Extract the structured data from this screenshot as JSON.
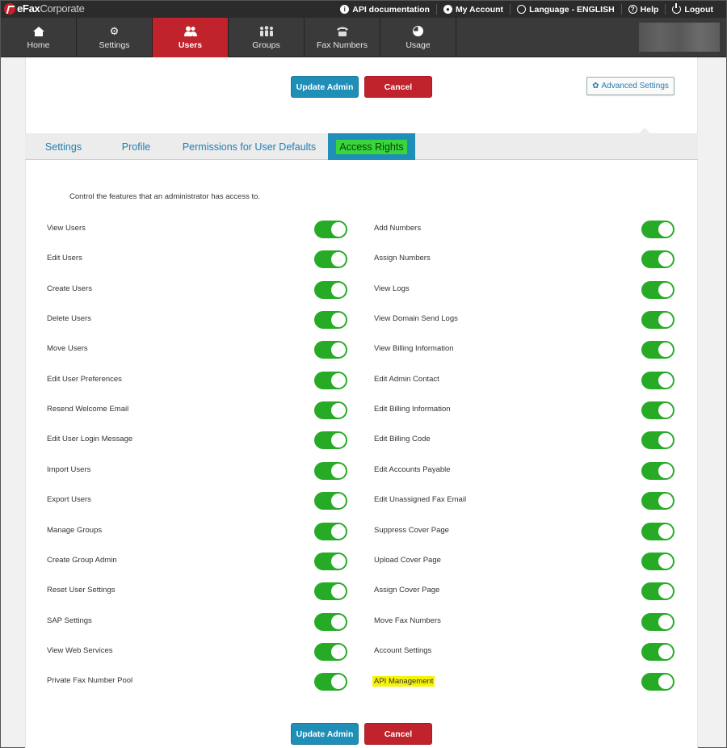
{
  "logo": {
    "bold": "eFax",
    "light": "Corporate"
  },
  "utility_links": [
    {
      "icon": "info-icon",
      "label": "API documentation"
    },
    {
      "icon": "account-icon",
      "label": "My Account"
    },
    {
      "icon": "globe-icon",
      "label": "Language - ENGLISH"
    },
    {
      "icon": "help-icon",
      "label": "Help"
    },
    {
      "icon": "power-icon",
      "label": "Logout"
    }
  ],
  "nav": [
    {
      "label": "Home",
      "icon": "home-icon"
    },
    {
      "label": "Settings",
      "icon": "gear-icon"
    },
    {
      "label": "Users",
      "icon": "users-icon",
      "active": true
    },
    {
      "label": "Groups",
      "icon": "groups-icon"
    },
    {
      "label": "Fax Numbers",
      "icon": "fax-icon"
    },
    {
      "label": "Usage",
      "icon": "pie-chart-icon"
    }
  ],
  "actions": {
    "update": "Update Admin",
    "cancel": "Cancel",
    "advanced": "Advanced Settings"
  },
  "tabs": [
    "Settings",
    "Profile",
    "Permissions for User Defaults",
    "Access Rights"
  ],
  "active_tab": "Access Rights",
  "intro": "Control the features that an administrator has access to.",
  "colors": {
    "accent_blue": "#1f8fb8",
    "danger_red": "#c0232b",
    "toggle_on": "#27ab27",
    "highlight_green": "#39d53b",
    "highlight_yellow": "#f6f30b"
  },
  "left_permissions": [
    {
      "label": "View Users",
      "on": true
    },
    {
      "label": "Edit Users",
      "on": true
    },
    {
      "label": "Create Users",
      "on": true
    },
    {
      "label": "Delete Users",
      "on": true
    },
    {
      "label": "Move Users",
      "on": true
    },
    {
      "label": "Edit User Preferences",
      "on": true
    },
    {
      "label": "Resend Welcome Email",
      "on": true
    },
    {
      "label": "Edit User Login Message",
      "on": true
    },
    {
      "label": "Import Users",
      "on": true
    },
    {
      "label": "Export Users",
      "on": true
    },
    {
      "label": "Manage Groups",
      "on": true
    },
    {
      "label": "Create Group Admin",
      "on": true
    },
    {
      "label": "Reset User Settings",
      "on": true
    },
    {
      "label": "SAP Settings",
      "on": true
    },
    {
      "label": "View Web Services",
      "on": true
    },
    {
      "label": "Private Fax Number Pool",
      "on": true
    }
  ],
  "right_permissions": [
    {
      "label": "Add Numbers",
      "on": true
    },
    {
      "label": "Assign Numbers",
      "on": true
    },
    {
      "label": "View Logs",
      "on": true
    },
    {
      "label": "View Domain Send Logs",
      "on": true
    },
    {
      "label": "View Billing Information",
      "on": true
    },
    {
      "label": "Edit Admin Contact",
      "on": true
    },
    {
      "label": "Edit Billing Information",
      "on": true
    },
    {
      "label": "Edit Billing Code",
      "on": true
    },
    {
      "label": "Edit Accounts Payable",
      "on": true
    },
    {
      "label": "Edit Unassigned Fax Email",
      "on": true
    },
    {
      "label": "Suppress Cover Page",
      "on": true
    },
    {
      "label": "Upload Cover Page",
      "on": true
    },
    {
      "label": "Assign Cover Page",
      "on": true
    },
    {
      "label": "Move Fax Numbers",
      "on": true
    },
    {
      "label": "Account Settings",
      "on": true
    },
    {
      "label": "API Management",
      "on": true,
      "highlighted": true
    }
  ]
}
